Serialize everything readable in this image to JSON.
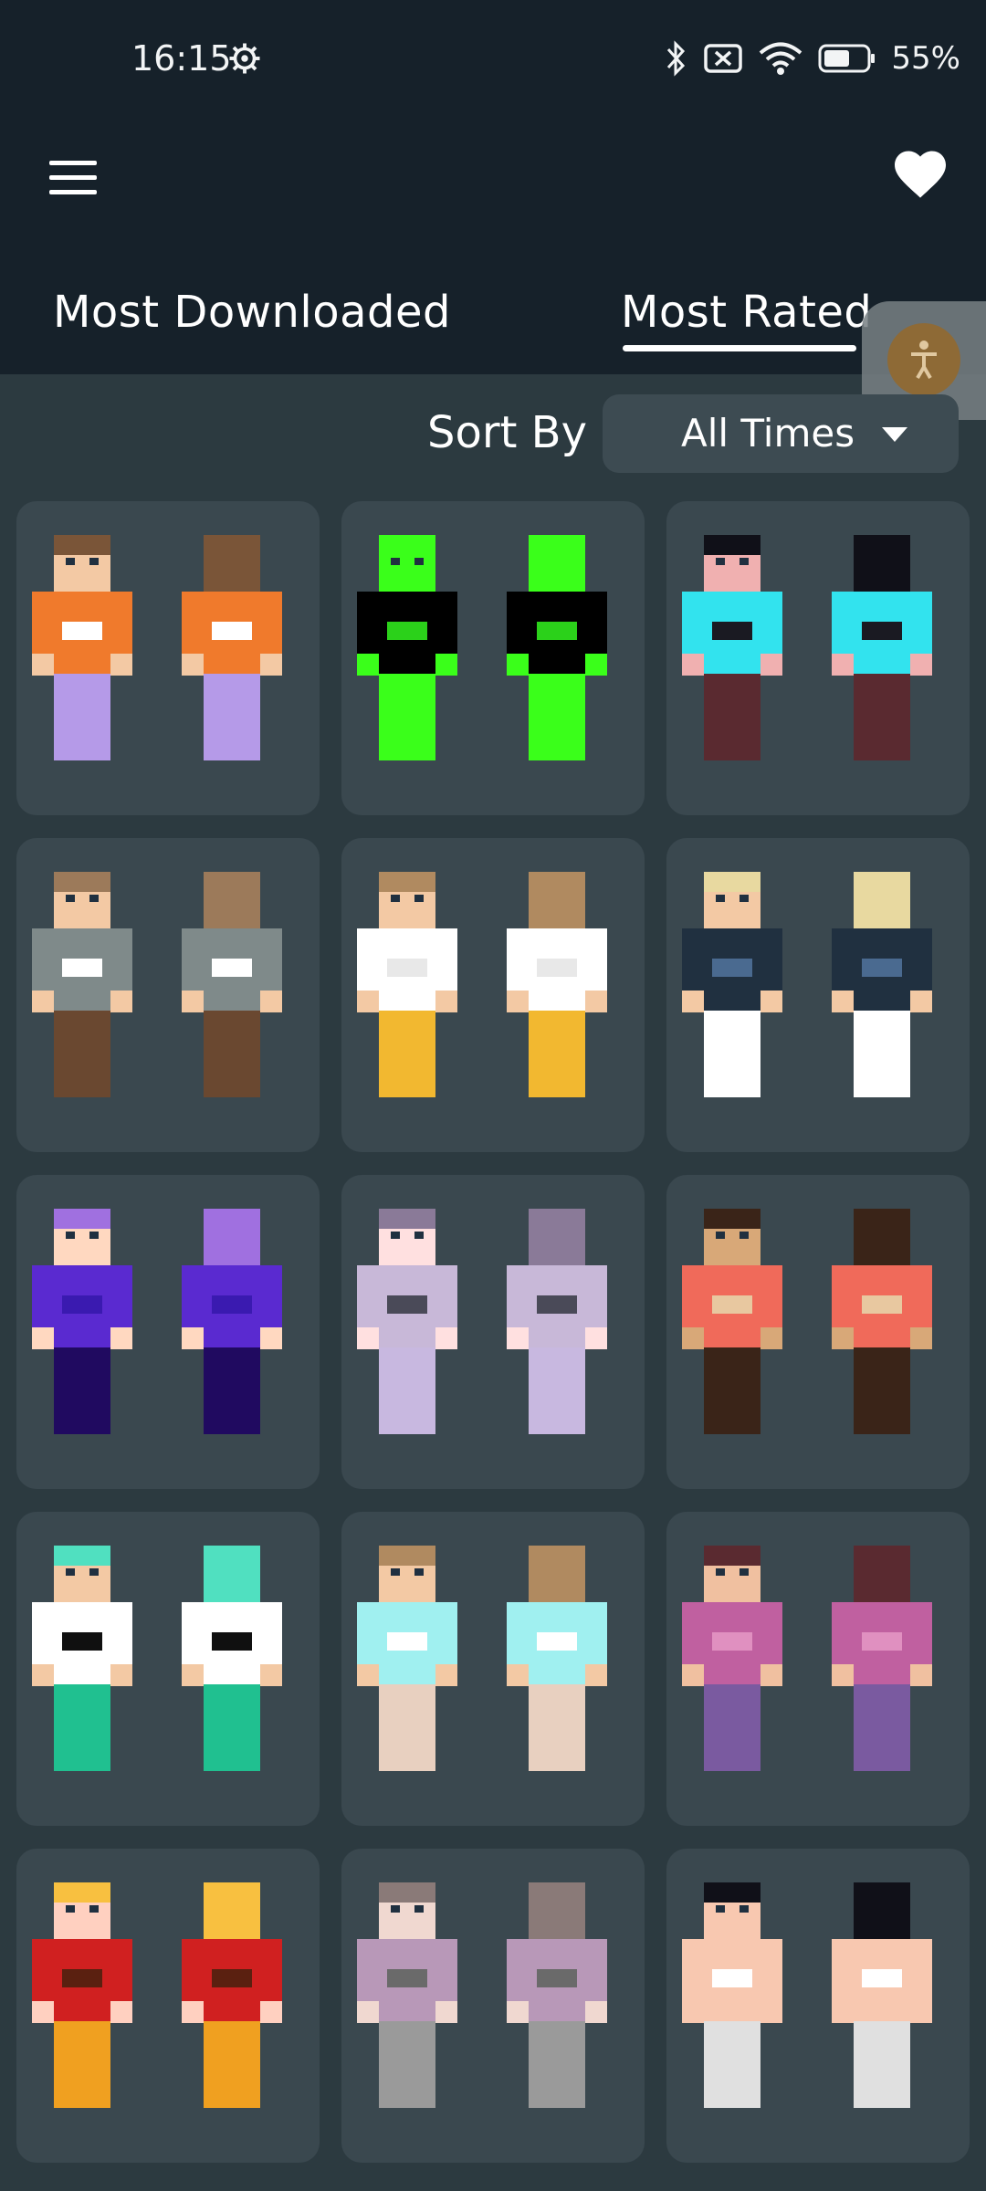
{
  "status_bar": {
    "time": "16:15",
    "battery": "55%",
    "icons": [
      "gear-icon",
      "bluetooth-icon",
      "sim-off-icon",
      "wifi-icon",
      "battery-icon"
    ]
  },
  "header": {
    "menu_icon": "menu-icon",
    "favorite_icon": "heart-icon"
  },
  "tabs": [
    {
      "label": "Most Downloaded",
      "selected": false
    },
    {
      "label": "Most Rated",
      "selected": true
    }
  ],
  "sort": {
    "label": "Sort By",
    "value": "All Times"
  },
  "skins": [
    {
      "palette": [
        "#7a5538",
        "#f07a2c",
        "#ffffff",
        "#b59ae8",
        "#f3c9a4"
      ]
    },
    {
      "palette": [
        "#3aff1a",
        "#000000",
        "#2bd11a",
        "#3aff1a",
        "#3aff1a"
      ]
    },
    {
      "palette": [
        "#101018",
        "#32e3ee",
        "#1a1a22",
        "#5a2a30",
        "#f0b0b0"
      ]
    },
    {
      "palette": [
        "#9c7a5a",
        "#7f8a8a",
        "#ffffff",
        "#6a4830",
        "#f3c9a4"
      ]
    },
    {
      "palette": [
        "#b08a60",
        "#ffffff",
        "#e8e8e8",
        "#f2b830",
        "#f3c9a4"
      ]
    },
    {
      "palette": [
        "#e8d9a0",
        "#203040",
        "#4a6a90",
        "#ffffff",
        "#f3c9a4"
      ]
    },
    {
      "palette": [
        "#a070e0",
        "#5a2ad0",
        "#3a1ab0",
        "#200a60",
        "#ffd8c0"
      ]
    },
    {
      "palette": [
        "#8a7a98",
        "#c8b8d8",
        "#4a4a58",
        "#c8b8e0",
        "#ffe0e0"
      ]
    },
    {
      "palette": [
        "#3a2418",
        "#f06a5a",
        "#e8c8a0",
        "#3a2418",
        "#d8a878"
      ]
    },
    {
      "palette": [
        "#50e0c0",
        "#ffffff",
        "#101010",
        "#20c090",
        "#f3c9a4"
      ]
    },
    {
      "palette": [
        "#b08a60",
        "#a0f0f0",
        "#ffffff",
        "#e8d0c0",
        "#f3c9a4"
      ]
    },
    {
      "palette": [
        "#5a2a30",
        "#c060a0",
        "#e090c0",
        "#7a5aa0",
        "#f0c0a0"
      ]
    },
    {
      "palette": [
        "#f8c040",
        "#d02020",
        "#5a2010",
        "#f0a020",
        "#ffd0c0"
      ]
    },
    {
      "palette": [
        "#8a7a78",
        "#b898b8",
        "#6a6a6a",
        "#9a9a9a",
        "#f0d8d0"
      ]
    },
    {
      "palette": [
        "#101018",
        "#f8c8b0",
        "#ffffff",
        "#e0e0e0",
        "#f8c8b0"
      ]
    }
  ]
}
